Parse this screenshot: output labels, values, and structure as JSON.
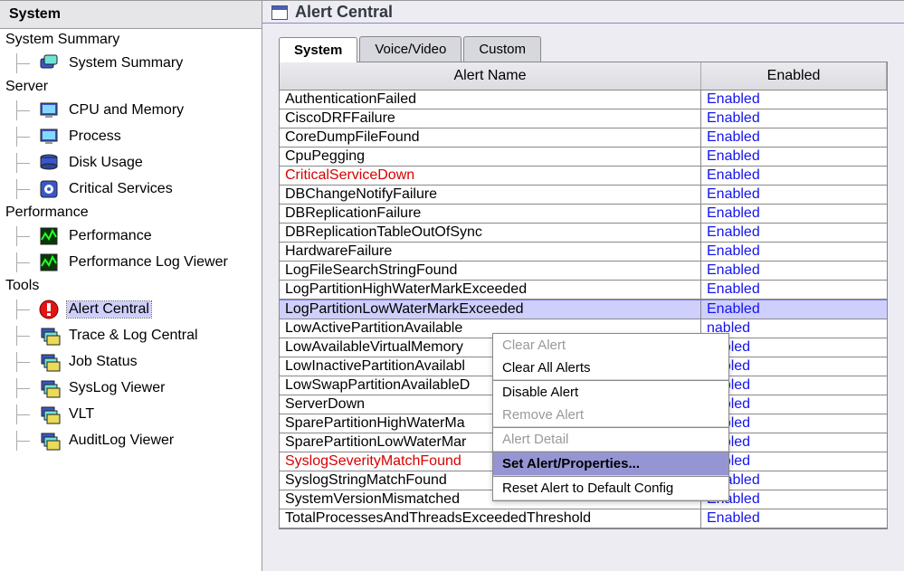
{
  "sidebar": {
    "header": "System",
    "groups": [
      {
        "label": "System Summary",
        "items": [
          {
            "label": "System Summary",
            "icon": "summary"
          }
        ]
      },
      {
        "label": "Server",
        "items": [
          {
            "label": "CPU and Memory",
            "icon": "monitor"
          },
          {
            "label": "Process",
            "icon": "monitor"
          },
          {
            "label": "Disk Usage",
            "icon": "disk"
          },
          {
            "label": "Critical Services",
            "icon": "gear"
          }
        ]
      },
      {
        "label": "Performance",
        "items": [
          {
            "label": "Performance",
            "icon": "perf"
          },
          {
            "label": "Performance Log Viewer",
            "icon": "perf"
          }
        ]
      },
      {
        "label": "Tools",
        "items": [
          {
            "label": "Alert Central",
            "icon": "alert",
            "selected": true
          },
          {
            "label": "Trace & Log Central",
            "icon": "stack"
          },
          {
            "label": "Job Status",
            "icon": "stack"
          },
          {
            "label": "SysLog Viewer",
            "icon": "stack"
          },
          {
            "label": "VLT",
            "icon": "stack"
          },
          {
            "label": "AuditLog Viewer",
            "icon": "stack"
          }
        ]
      }
    ]
  },
  "main": {
    "title": "Alert Central",
    "tabs": [
      {
        "label": "System",
        "active": true
      },
      {
        "label": "Voice/Video"
      },
      {
        "label": "Custom"
      }
    ],
    "columns": {
      "name": "Alert Name",
      "enabled": "Enabled"
    },
    "enabled_label": "Enabled",
    "partial_enabled_label": "nabled",
    "rows": [
      {
        "name": "AuthenticationFailed"
      },
      {
        "name": "CiscoDRFFailure"
      },
      {
        "name": "CoreDumpFileFound"
      },
      {
        "name": "CpuPegging"
      },
      {
        "name": "CriticalServiceDown",
        "critical": true
      },
      {
        "name": "DBChangeNotifyFailure"
      },
      {
        "name": "DBReplicationFailure"
      },
      {
        "name": "DBReplicationTableOutOfSync"
      },
      {
        "name": "HardwareFailure"
      },
      {
        "name": "LogFileSearchStringFound"
      },
      {
        "name": "LogPartitionHighWaterMarkExceeded"
      },
      {
        "name": "LogPartitionLowWaterMarkExceeded",
        "selected": true
      },
      {
        "name": "LowActivePartitionAvailable",
        "covered": true
      },
      {
        "name": "LowAvailableVirtualMemory",
        "covered": true
      },
      {
        "name": "LowInactivePartitionAvailabl",
        "covered": true
      },
      {
        "name": "LowSwapPartitionAvailableD",
        "covered": true
      },
      {
        "name": "ServerDown",
        "covered": true
      },
      {
        "name": "SparePartitionHighWaterMa",
        "covered": true
      },
      {
        "name": "SparePartitionLowWaterMar",
        "covered": true
      },
      {
        "name": "SyslogSeverityMatchFound",
        "critical": true,
        "covered": true
      },
      {
        "name": "SyslogStringMatchFound"
      },
      {
        "name": "SystemVersionMismatched"
      },
      {
        "name": "TotalProcessesAndThreadsExceededThreshold"
      }
    ]
  },
  "ctxmenu": [
    {
      "label": "Clear Alert",
      "disabled": true
    },
    {
      "label": "Clear All Alerts",
      "sepafter": true
    },
    {
      "label": "Disable Alert"
    },
    {
      "label": "Remove Alert",
      "disabled": true,
      "sepafter": true
    },
    {
      "label": "Alert Detail",
      "disabled": true,
      "sepafter": true
    },
    {
      "label": "Set Alert/Properties...",
      "selected": true,
      "sepafter": true
    },
    {
      "label": "Reset Alert to Default Config"
    }
  ]
}
